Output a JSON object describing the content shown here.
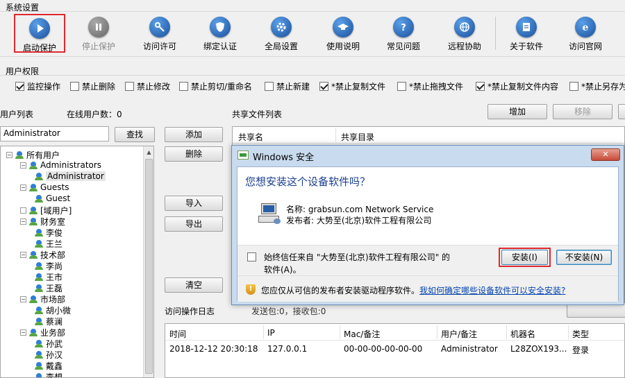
{
  "system_settings": {
    "title": "系统设置",
    "buttons": [
      {
        "label": "启动保护",
        "icon": "play-icon"
      },
      {
        "label": "停止保护",
        "icon": "pause-icon"
      },
      {
        "label": "访问许可",
        "icon": "key-icon"
      },
      {
        "label": "绑定认证",
        "icon": "shield-icon"
      },
      {
        "label": "全局设置",
        "icon": "gear-icon"
      },
      {
        "label": "使用说明",
        "icon": "graduation-cap-icon"
      },
      {
        "label": "常见问题",
        "icon": "question-icon"
      },
      {
        "label": "远程协助",
        "icon": "globe-icon"
      },
      {
        "label": "关于软件",
        "icon": "document-icon"
      },
      {
        "label": "访问官网",
        "icon": "ie-icon"
      }
    ]
  },
  "user_permissions": {
    "title": "用户权限",
    "items": [
      {
        "label": "监控操作",
        "checked": true
      },
      {
        "label": "禁止删除",
        "checked": false
      },
      {
        "label": "禁止修改",
        "checked": false
      },
      {
        "label": "禁止剪切/重命名",
        "checked": false
      },
      {
        "label": "禁止新建",
        "checked": false
      },
      {
        "label": "*禁止复制文件",
        "checked": true
      },
      {
        "label": "*禁止拖拽文件",
        "checked": false
      },
      {
        "label": "*禁止复制文件内容",
        "checked": true
      },
      {
        "label": "*禁止另存为",
        "checked": false
      }
    ]
  },
  "user_list": {
    "title": "用户列表",
    "online_label": "在线用户数：0",
    "search_value": "Administrator",
    "search_button": "查找",
    "tree": [
      {
        "label": "所有用户",
        "level": 0,
        "type": "group",
        "toggle": "−"
      },
      {
        "label": "Administrators",
        "level": 1,
        "type": "group",
        "toggle": "−"
      },
      {
        "label": "Administrator",
        "level": 2,
        "type": "user",
        "selected": true
      },
      {
        "label": "Guests",
        "level": 1,
        "type": "group",
        "toggle": "−"
      },
      {
        "label": "Guest",
        "level": 2,
        "type": "user"
      },
      {
        "label": "[域用户]",
        "level": 1,
        "type": "group",
        "toggle": ""
      },
      {
        "label": "财务室",
        "level": 1,
        "type": "group",
        "toggle": "−"
      },
      {
        "label": "李俊",
        "level": 2,
        "type": "user"
      },
      {
        "label": "王兰",
        "level": 2,
        "type": "user"
      },
      {
        "label": "技术部",
        "level": 1,
        "type": "group",
        "toggle": "−"
      },
      {
        "label": "李尚",
        "level": 2,
        "type": "user"
      },
      {
        "label": "王市",
        "level": 2,
        "type": "user"
      },
      {
        "label": "王磊",
        "level": 2,
        "type": "user"
      },
      {
        "label": "市场部",
        "level": 1,
        "type": "group",
        "toggle": "−"
      },
      {
        "label": "胡小微",
        "level": 2,
        "type": "user"
      },
      {
        "label": "蔡澜",
        "level": 2,
        "type": "user"
      },
      {
        "label": "业务部",
        "level": 1,
        "type": "group",
        "toggle": "−"
      },
      {
        "label": "孙武",
        "level": 2,
        "type": "user"
      },
      {
        "label": "孙汉",
        "level": 2,
        "type": "user"
      },
      {
        "label": "戴鑫",
        "level": 2,
        "type": "user"
      },
      {
        "label": "李想",
        "level": 2,
        "type": "user"
      }
    ]
  },
  "middle_buttons": {
    "add": "添加",
    "delete": "删除",
    "import": "导入",
    "export": "导出",
    "clear": "清空"
  },
  "shared_files": {
    "title": "共享文件列表",
    "add_button": "增加",
    "remove_button": "移除",
    "columns": [
      "共享名",
      "共享目录"
    ]
  },
  "access_log": {
    "title": "访问操作日志",
    "stats": "发送包:0，接收包:0",
    "columns": [
      "时间",
      "IP",
      "Mac/备注",
      "用户/备注",
      "机器名",
      "类型"
    ],
    "rows": [
      [
        "2018-12-12 20:30:18",
        "127.0.0.1",
        "00-00-00-00-00-00",
        "Administrator",
        "L28ZOX193...",
        "登录"
      ]
    ]
  },
  "dialog": {
    "title": "Windows 安全",
    "heading": "您想安装这个设备软件吗？",
    "name_line": "名称: grabsun.com Network Service",
    "publisher_line": "发布者: 大势至(北京)软件工程有限公司",
    "trust_line1": "始终信任来自 \"大势至(北京)软件工程有限公司\" 的",
    "trust_line2": "软件(A)。",
    "install_button": "安装(I)",
    "dont_install_button": "不安装(N)",
    "warning_text": "您应仅从可信的发布者安装驱动程序软件。",
    "warning_link": "我如何确定哪些设备软件可以安全安装?",
    "close_symbol": "✕"
  },
  "colors": {
    "accent": "#1a4f9c",
    "highlight": "#e0282e",
    "link": "#0645ad",
    "heading": "#1a3f8f"
  }
}
